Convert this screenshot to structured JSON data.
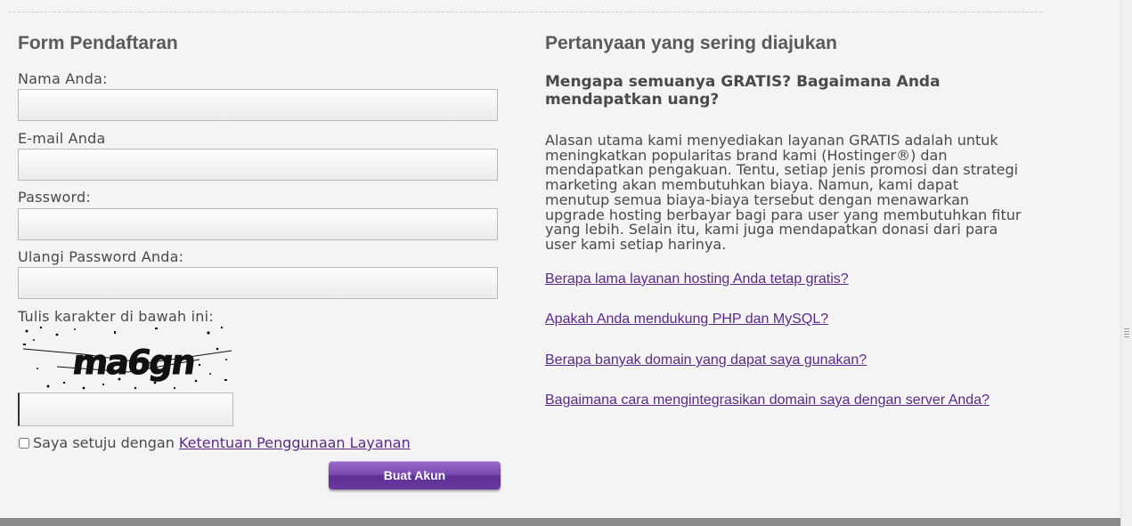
{
  "form": {
    "title": "Form Pendaftaran",
    "name_label": "Nama Anda:",
    "email_label": "E-mail Anda",
    "password_label": "Password:",
    "repeat_password_label": "Ulangi Password Anda:",
    "captcha_label": "Tulis karakter di bawah ini:",
    "captcha_text": "ma6gn",
    "agree_text": "Saya setuju dengan",
    "terms_link": "Ketentuan Penggunaan Layanan",
    "submit_label": "Buat Akun"
  },
  "faq": {
    "title": "Pertanyaan yang sering diajukan",
    "question": "Mengapa semuanya GRATIS? Bagaimana Anda mendapatkan uang?",
    "answer": "Alasan utama kami menyediakan layanan GRATIS adalah untuk meningkatkan popularitas brand kami (Hostinger®) dan mendapatkan pengakuan. Tentu, setiap jenis promosi dan strategi marketing akan membutuhkan biaya. Namun, kami dapat menutup semua biaya-biaya tersebut dengan menawarkan upgrade hosting berbayar bagi para user yang membutuhkan fitur yang lebih. Selain itu, kami juga mendapatkan donasi dari para user kami setiap harinya.",
    "links": [
      "Berapa lama layanan hosting Anda tetap gratis?",
      "Apakah Anda mendukung PHP dan MySQL?",
      "Berapa banyak domain yang dapat saya gunakan?",
      "Bagaimana cara mengintegrasikan domain saya dengan server Anda?"
    ]
  },
  "colors": {
    "link": "#5b2a86",
    "button": "#7d4cb4",
    "background": "#f4f4f4"
  }
}
